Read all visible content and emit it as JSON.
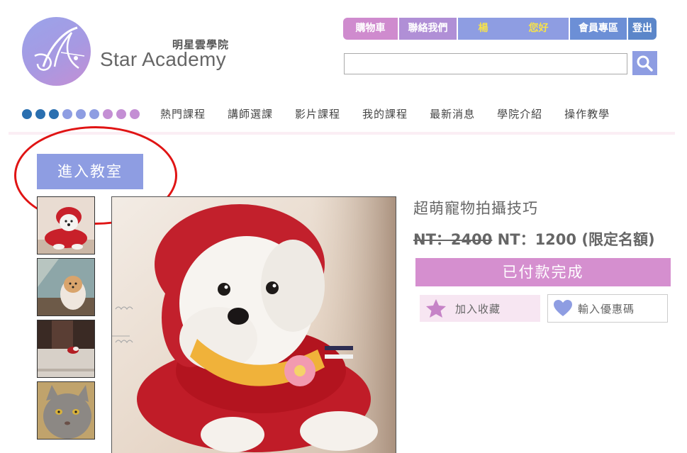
{
  "logo": {
    "cn": "明星雲學院",
    "en": "Star Academy"
  },
  "topnav": {
    "cart": "購物車",
    "contact": "聯絡我們",
    "user": "楊",
    "greeting": "您好",
    "member": "會員專區",
    "logout": "登出"
  },
  "search": {
    "value": "",
    "placeholder": ""
  },
  "nav_dots": [
    "#2a6fb0",
    "#2a6fb0",
    "#2a6fb0",
    "#8e9de2",
    "#8e9de2",
    "#8e9de2",
    "#c48fd4",
    "#c48fd4",
    "#c48fd4"
  ],
  "mainnav": [
    "熱門課程",
    "講師選課",
    "影片課程",
    "我的課程",
    "最新消息",
    "學院介紹",
    "操作教學"
  ],
  "enter_classroom": "進入教室",
  "product": {
    "title": "超萌寵物拍攝技巧",
    "old_price": "NT：2400",
    "new_price": "NT：1200",
    "note": "(限定名額)",
    "paid_label": "已付款完成",
    "favorite_label": "加入收藏",
    "coupon_label": "輸入優惠碼"
  },
  "colors": {
    "accent_purple": "#8e9de2",
    "accent_pink": "#d58fcf",
    "highlight_red": "#e01414"
  }
}
